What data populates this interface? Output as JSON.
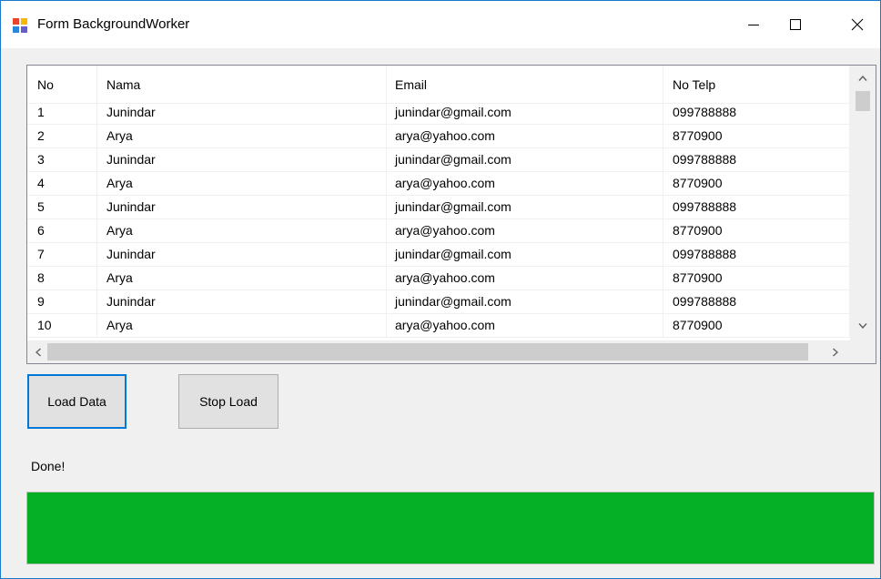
{
  "window": {
    "title": "Form BackgroundWorker"
  },
  "grid": {
    "columns": [
      "No",
      "Nama",
      "Email",
      "No Telp"
    ],
    "rows": [
      [
        "1",
        "Junindar",
        "junindar@gmail.com",
        "099788888"
      ],
      [
        "2",
        "Arya",
        "arya@yahoo.com",
        "8770900"
      ],
      [
        "3",
        "Junindar",
        "junindar@gmail.com",
        "099788888"
      ],
      [
        "4",
        "Arya",
        "arya@yahoo.com",
        "8770900"
      ],
      [
        "5",
        "Junindar",
        "junindar@gmail.com",
        "099788888"
      ],
      [
        "6",
        "Arya",
        "arya@yahoo.com",
        "8770900"
      ],
      [
        "7",
        "Junindar",
        "junindar@gmail.com",
        "099788888"
      ],
      [
        "8",
        "Arya",
        "arya@yahoo.com",
        "8770900"
      ],
      [
        "9",
        "Junindar",
        "junindar@gmail.com",
        "099788888"
      ],
      [
        "10",
        "Arya",
        "arya@yahoo.com",
        "8770900"
      ]
    ]
  },
  "buttons": {
    "load_label": "Load Data",
    "stop_label": "Stop Load"
  },
  "status": {
    "text": "Done!"
  },
  "progress": {
    "value": 1.0,
    "color": "#06b025"
  },
  "icons": {
    "app": "form-window-icon",
    "minimize": "minimize-icon",
    "maximize": "maximize-icon",
    "close": "close-icon"
  }
}
